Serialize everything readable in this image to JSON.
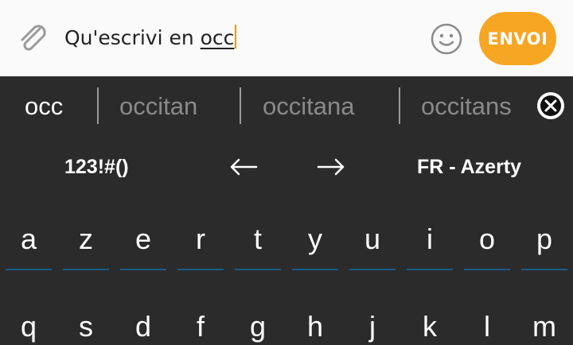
{
  "composer": {
    "text_prefix": "Qu'escrivi en ",
    "text_current_word": "occ",
    "send_label": "ENVOI",
    "accent_color": "#f6a623"
  },
  "keyboard": {
    "suggestions": [
      "occ",
      "occitan",
      "occitana",
      "occitans"
    ],
    "toolbar": {
      "symbols_label": "123!#()",
      "left_arrow": "←",
      "right_arrow": "→",
      "layout_label": "FR - Azerty"
    },
    "rows": [
      [
        "a",
        "z",
        "e",
        "r",
        "t",
        "y",
        "u",
        "i",
        "o",
        "p"
      ],
      [
        "q",
        "s",
        "d",
        "f",
        "g",
        "h",
        "j",
        "k",
        "l",
        "m"
      ]
    ]
  },
  "icons": [
    "paperclip-icon",
    "emoji-icon",
    "close-icon"
  ]
}
